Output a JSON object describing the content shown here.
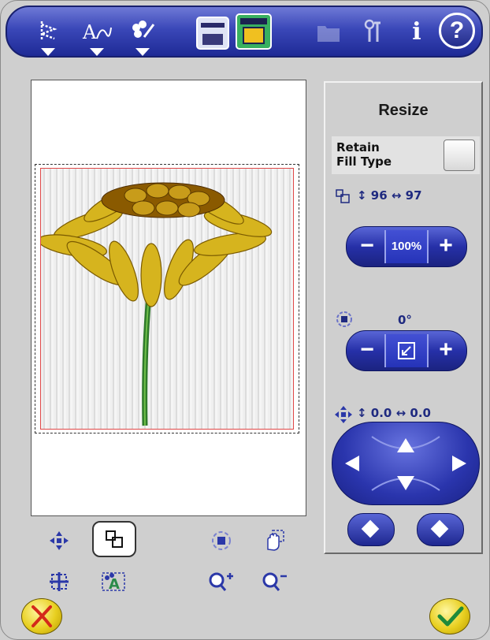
{
  "panel": {
    "title": "Resize",
    "retain_fill_label": "Retain\nFill Type",
    "size_readout": "↕ 96  ↔ 97",
    "scale_button_label": "100%",
    "rotation_readout": "0°",
    "position_readout": "↕  0.0   ↔   0.0"
  },
  "toolbar": {
    "help_label": "?",
    "info_label": "i"
  },
  "colors": {
    "toolbar_blue": "#2a35ad",
    "selection_red": "#e04848",
    "cancel_yellow": "#e8cf20"
  }
}
